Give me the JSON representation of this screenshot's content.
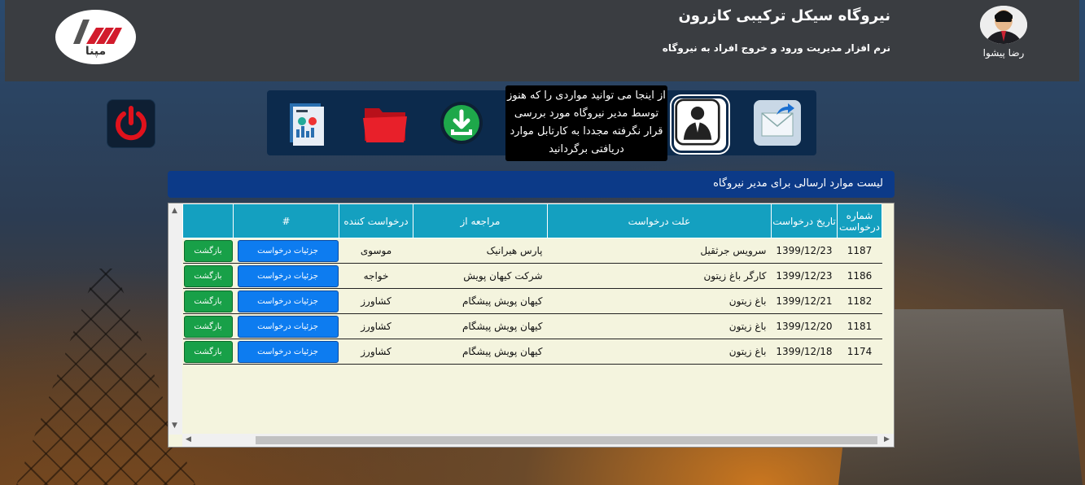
{
  "header": {
    "title": "نیروگاه سیکل ترکیبی کازرون",
    "subtitle": "نرم افزار مدیریت ورود و خروج افراد به نیروگاه",
    "logo_text": "مپنا",
    "user_name": "رضا پیشوا"
  },
  "toolbar": {
    "icons": [
      "power-icon",
      "report-dashboard-icon",
      "folder-icon",
      "download-icon",
      "manager-icon",
      "send-mail-icon"
    ],
    "tooltip": "از اینجا می توانید مواردی را که هنوز توسط مدیر نیروگاه مورد بررسی قرار نگرفته مجددا به کارتابل موارد دریافتی برگردانید"
  },
  "list": {
    "title": "لیست موارد ارسالی برای مدیر نیروگاه",
    "columns": {
      "number": "شماره درخواست",
      "date": "تاریخ درخواست",
      "reason": "علت درخواست",
      "referrer": "مراجعه از",
      "requester": "درخواست کننده",
      "hash": "#"
    },
    "rows": [
      {
        "number": "1187",
        "date": "1399/12/23",
        "reason": "سرویس جرثقیل",
        "referrer": "پارس هیرانیک",
        "requester": "موسوی",
        "detail": "جزئیات درخواست",
        "back": "بازگشت"
      },
      {
        "number": "1186",
        "date": "1399/12/23",
        "reason": "کارگر باغ زیتون",
        "referrer": "شرکت کیهان پویش",
        "requester": "خواجه",
        "detail": "جزئیات درخواست",
        "back": "بازگشت"
      },
      {
        "number": "1182",
        "date": "1399/12/21",
        "reason": "باغ زیتون",
        "referrer": "کیهان پویش پیشگام",
        "requester": "کشاورز",
        "detail": "جزئیات درخواست",
        "back": "بازگشت"
      },
      {
        "number": "1181",
        "date": "1399/12/20",
        "reason": "باغ زیتون",
        "referrer": "کیهان پویش پیشگام",
        "requester": "کشاورز",
        "detail": "جزئیات درخواست",
        "back": "بازگشت"
      },
      {
        "number": "1174",
        "date": "1399/12/18",
        "reason": "باغ زیتون",
        "referrer": "کیهان پویش پیشگام",
        "requester": "کشاورز",
        "detail": "جزئیات درخواست",
        "back": "بازگشت"
      }
    ]
  }
}
